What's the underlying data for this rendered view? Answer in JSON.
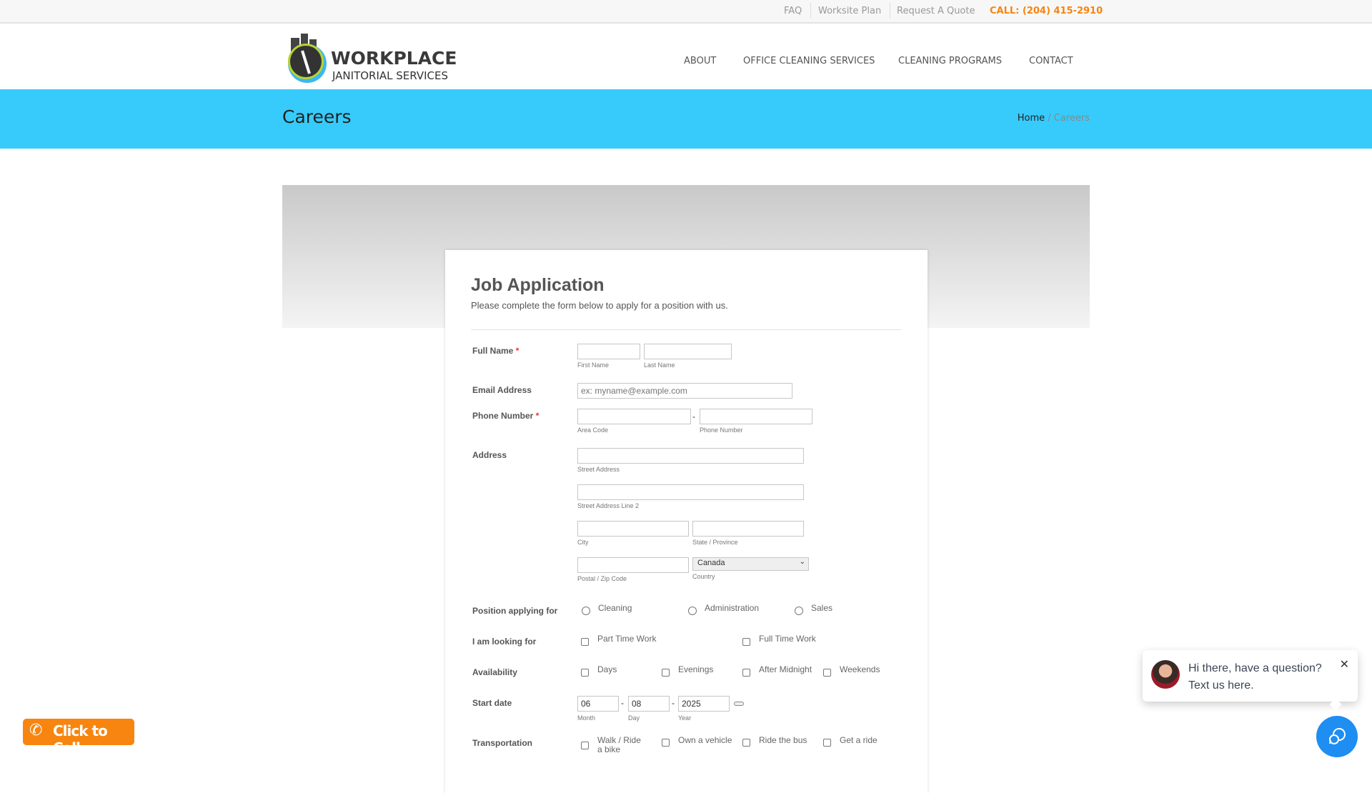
{
  "topbar": {
    "links": [
      "FAQ",
      "Worksite Plan",
      "Request A Quote"
    ],
    "call": "CALL: (204) 415-2910"
  },
  "logo": {
    "line1": "WORKPLACE",
    "line2": "JANITORIAL SERVICES"
  },
  "nav": [
    "ABOUT",
    "OFFICE CLEANING SERVICES",
    "CLEANING PROGRAMS",
    "CONTACT"
  ],
  "band": {
    "title": "Careers",
    "crumb_home": "Home",
    "crumb_sep": "/",
    "crumb_current": "Careers"
  },
  "form": {
    "title": "Job Application",
    "subtitle": "Please complete the form below to apply for a position with us.",
    "required_mark": "*",
    "full_name": {
      "label": "Full Name",
      "first": "First Name",
      "last": "Last Name"
    },
    "email": {
      "label": "Email Address",
      "placeholder": "ex: myname@example.com"
    },
    "phone": {
      "label": "Phone Number",
      "area": "Area Code",
      "number": "Phone Number",
      "sep": "-"
    },
    "address": {
      "label": "Address",
      "street": "Street Address",
      "street2": "Street Address Line 2",
      "city": "City",
      "state": "State / Province",
      "postal": "Postal / Zip Code",
      "country_label": "Country",
      "country": "Canada"
    },
    "position": {
      "label": "Position applying for",
      "options": [
        "Cleaning",
        "Administration",
        "Sales"
      ]
    },
    "looking": {
      "label": "I am looking for",
      "options": [
        "Part Time Work",
        "Full Time Work"
      ]
    },
    "availability": {
      "label": "Availability",
      "options": [
        "Days",
        "Evenings",
        "After Midnight",
        "Weekends"
      ]
    },
    "start": {
      "label": "Start date",
      "month": "06",
      "day": "08",
      "year": "2025",
      "month_label": "Month",
      "day_label": "Day",
      "year_label": "Year",
      "sep": "-"
    },
    "transport": {
      "label": "Transportation",
      "options": [
        "Walk / Ride a bike",
        "Own a vehicle",
        "Ride the bus",
        "Get a ride"
      ]
    }
  },
  "chat": {
    "line1": "Hi there, have a question?",
    "line2": "Text us here."
  },
  "call_button": "Click to Call",
  "colors": {
    "band": "#37cbfc",
    "call": "#f7850f",
    "chat": "#1e8ef2"
  }
}
